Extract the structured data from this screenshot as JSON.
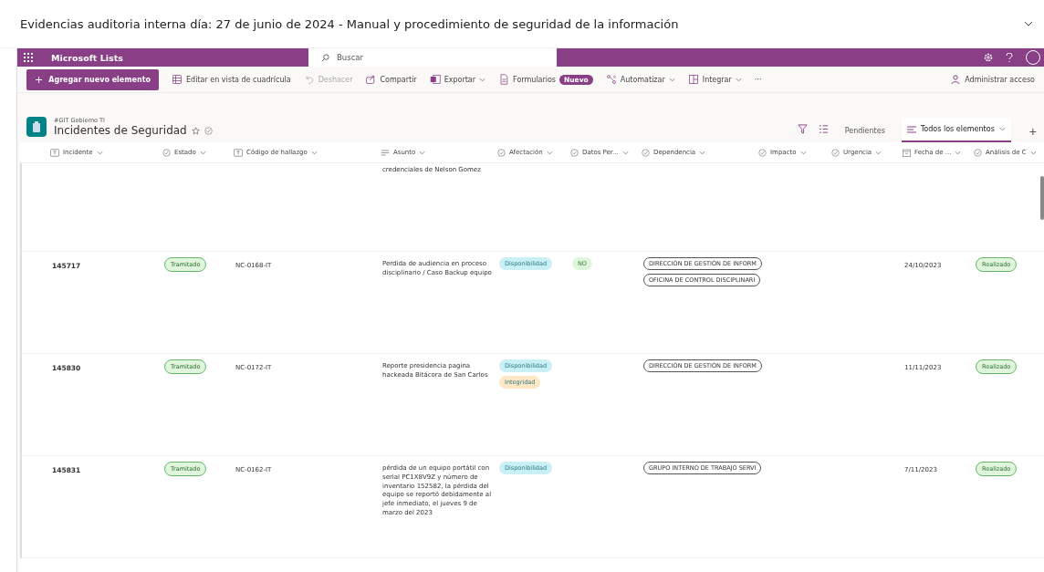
{
  "page_title": "Evidencias auditoria interna día: 27 de junio de 2024 - Manual y procedimiento de seguridad de la información",
  "app_bar": {
    "app_name": "Microsoft Lists",
    "search_placeholder": "Buscar"
  },
  "toolbar": {
    "primary_icon": "+",
    "primary": "Agregar nuevo elemento",
    "items": [
      {
        "label": "Editar en vista de cuadrícula",
        "disabled": false,
        "menu": false
      },
      {
        "label": "Deshacer",
        "disabled": true,
        "menu": false
      },
      {
        "label": "Compartir",
        "disabled": false,
        "menu": false
      },
      {
        "label": "Exportar",
        "disabled": false,
        "menu": true
      },
      {
        "label": "Formularios",
        "disabled": false,
        "menu": false,
        "badge": "Nuevo"
      },
      {
        "label": "Automatizar",
        "disabled": false,
        "menu": true
      },
      {
        "label": "Integrar",
        "disabled": false,
        "menu": true
      }
    ],
    "more": "···",
    "access": "Administrar acceso"
  },
  "list": {
    "site": "#GIT Gobierno TI",
    "title": "Incidentes de Seguridad",
    "views": [
      {
        "label": "Pendientes",
        "selected": false
      },
      {
        "label": "Todos los elementos",
        "selected": true
      }
    ],
    "add_view": "+"
  },
  "table": {
    "columns": [
      {
        "label": "Incidente",
        "kind": "text"
      },
      {
        "label": "Estado",
        "kind": "choice"
      },
      {
        "label": "Código de hallazgo",
        "kind": "text"
      },
      {
        "label": "Asunto",
        "kind": "multiline"
      },
      {
        "label": "Afectación",
        "kind": "choice"
      },
      {
        "label": "Datos Per...",
        "kind": "choice"
      },
      {
        "label": "Dependencia",
        "kind": "choice"
      },
      {
        "label": "Impacto",
        "kind": "choice"
      },
      {
        "label": "Urgencia",
        "kind": "choice"
      },
      {
        "label": "Fecha de ...",
        "kind": "date"
      },
      {
        "label": "Análisis de C",
        "kind": "choice"
      }
    ],
    "rows": [
      {
        "incidente": "",
        "estado": "",
        "codigo": "",
        "asunto": "credenciales de Nelson Gomez",
        "afectacion": [],
        "datos": "",
        "dependencia": [],
        "fecha": "",
        "analisis": ""
      },
      {
        "incidente": "145717",
        "estado": "Tramitado",
        "codigo": "NC-0168-IT",
        "asunto": "Perdida de audiencia en proceso disciplinario / Caso Backup equipo",
        "afectacion": [
          {
            "label": "Disponibilidad",
            "color": "#c9f0f4"
          }
        ],
        "datos": "NO",
        "dependencia": [
          "DIRECCIÓN DE GESTIÓN DE INFORM",
          "OFICINA DE CONTROL DISCIPLINARI"
        ],
        "fecha": "24/10/2023",
        "analisis": "Realizado"
      },
      {
        "incidente": "145830",
        "estado": "Tramitado",
        "codigo": "NC-0172-IT",
        "asunto": "Reporte presidencia pagina hackeada Bitácora de San Carlos",
        "afectacion": [
          {
            "label": "Disponibilidad",
            "color": "#c9f0f4"
          },
          {
            "label": "Integridad",
            "color": "#fde7c4"
          }
        ],
        "datos": "",
        "dependencia": [
          "DIRECCIÓN DE GESTIÓN DE INFORM"
        ],
        "fecha": "11/11/2023",
        "analisis": "Realizado"
      },
      {
        "incidente": "145831",
        "estado": "Tramitado",
        "codigo": "NC-0162-IT",
        "asunto": "pérdida de un equipo portátil con serial PC1X8V9Z y número de inventario 152582, la pérdida del equipo se reportó debidamente al jefe inmediato, el jueves 9 de marzo del 2023",
        "afectacion": [
          {
            "label": "Disponibilidad",
            "color": "#c9f0f4"
          }
        ],
        "datos": "",
        "dependencia": [
          "GRUPO INTERNO DE TRABAJO SERVI"
        ],
        "fecha": "7/11/2023",
        "analisis": "Realizado"
      }
    ]
  }
}
